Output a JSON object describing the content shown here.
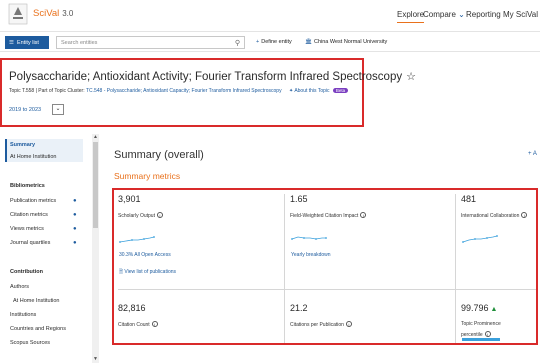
{
  "header": {
    "brand": "SciVal",
    "brand_version": "3.0",
    "nav": [
      "Explore",
      "Compare",
      "Reporting",
      "My SciVal"
    ],
    "active_nav": "Explore",
    "accent": "#e9711c"
  },
  "searchbar": {
    "entity_button": "Entity list",
    "placeholder": "Search entities",
    "define_entity": "Define entity",
    "institution": "China West Normal University"
  },
  "topic": {
    "title": "Polysaccharide; Antioxidant Activity; Fourier Transform Infrared Spectroscopy",
    "topic_id": "Topic T.558",
    "cluster_prefix": "Part of Topic Cluster",
    "cluster_link": "TC.548 - Polysaccharide; Antioxidant Capacity; Fourier Transform Infrared Spectroscopy",
    "about": "About this Topic",
    "beta": "Beta",
    "years": "2019 to 2023"
  },
  "sidebar": {
    "items": [
      {
        "label": "Summary",
        "strong": true
      },
      {
        "label": "At Home Institution",
        "strong": false
      },
      {
        "label": "Bibliometrics",
        "strong": true
      },
      {
        "label": "Publication metrics",
        "strong": false,
        "plus": true
      },
      {
        "label": "Citation metrics",
        "strong": false,
        "plus": true
      },
      {
        "label": "Views metrics",
        "strong": false,
        "plus": true
      },
      {
        "label": "Journal quartiles",
        "strong": false,
        "plus": true
      },
      {
        "label": "Contribution",
        "strong": true
      },
      {
        "label": "Authors",
        "strong": false
      },
      {
        "label": "At Home Institution",
        "strong": false
      },
      {
        "label": "Institutions",
        "strong": false
      },
      {
        "label": "Countries and Regions",
        "strong": false
      },
      {
        "label": "Scopus Sources",
        "strong": false
      }
    ]
  },
  "main": {
    "title": "Summary (overall)",
    "subtitle": "Summary metrics",
    "add_link": "+ A"
  },
  "metrics": {
    "scholarly_output": {
      "value": "3,901",
      "label": "Scholarly Output",
      "sub": "30.3% All Open Access",
      "link": "View list of publications"
    },
    "fwci": {
      "value": "1.65",
      "label": "Field-Weighted Citation Impact",
      "sub": "Yearly breakdown"
    },
    "collab": {
      "value": "481",
      "label": "International Collaboration"
    },
    "citation_count": {
      "value": "82,816",
      "label": "Citation Count"
    },
    "cites_per_pub": {
      "value": "21.2",
      "label": "Citations per Publication"
    },
    "prominence": {
      "value": "99.796",
      "label": "Topic Prominence",
      "label2": "percentile",
      "level": 0.998
    }
  }
}
